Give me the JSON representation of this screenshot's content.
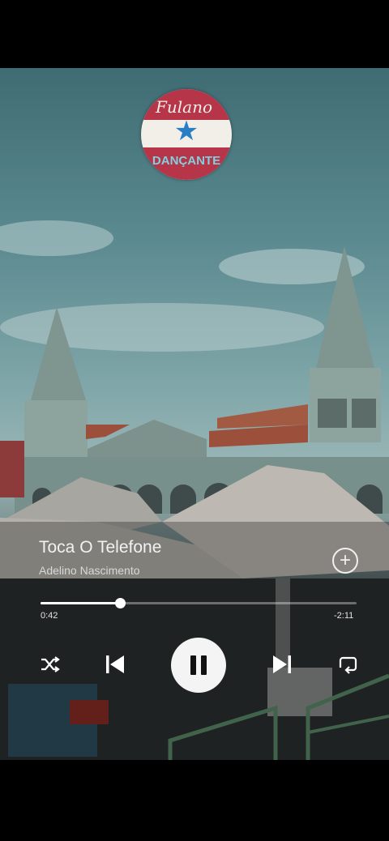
{
  "logo": {
    "brand": "Fulano",
    "subtitle": "DANÇANTE",
    "star": "★"
  },
  "track": {
    "title": "Toca O Telefone",
    "artist": "Adelino Nascimento"
  },
  "progress": {
    "elapsed": "0:42",
    "remaining": "-2:11",
    "fraction": 0.25
  },
  "controls": {
    "add": "+",
    "shuffle_icon": "shuffle-icon",
    "previous_icon": "skip-previous-icon",
    "play_pause_icon": "pause-icon",
    "next_icon": "skip-next-icon",
    "repeat_icon": "repeat-icon"
  },
  "colors": {
    "accent": "#ffffff",
    "logo_red": "#b73548",
    "logo_star": "#2a7fc4"
  }
}
